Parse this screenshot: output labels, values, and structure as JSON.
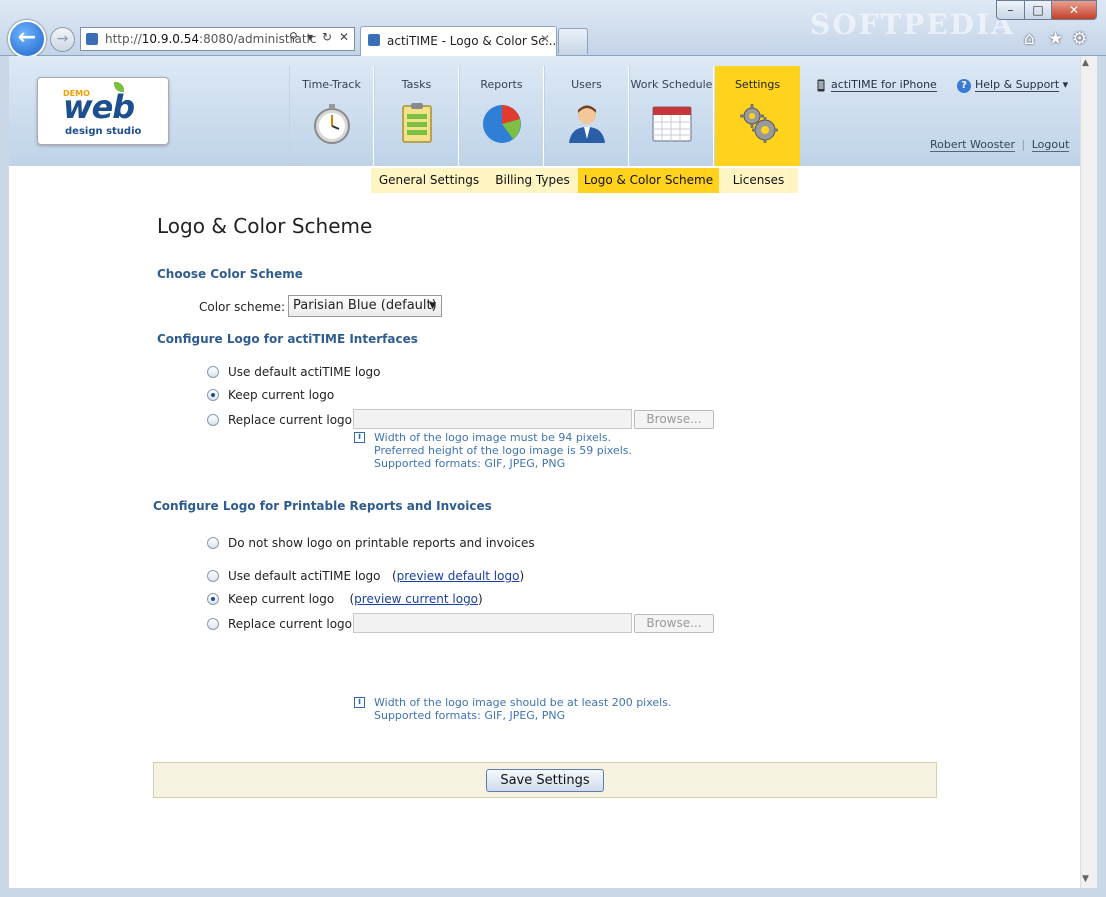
{
  "browser": {
    "url_prefix": "http://",
    "url_host": "10.9.0.54",
    "url_rest": ":8080/administratic",
    "tab_title": "actiTIME - Logo & Color Sc...",
    "watermark": "SOFTPEDIA",
    "min_label": "–",
    "max_label": "□",
    "close_label": "✕",
    "back_glyph": "←",
    "forward_glyph": "→",
    "search_glyph": "⚲",
    "dropdown_glyph": "▾",
    "refresh_glyph": "↻",
    "stop_glyph": "✕",
    "home_glyph": "⌂",
    "star_glyph": "★",
    "gear_glyph": "⚙"
  },
  "logo": {
    "demo": "DEMO",
    "word": "web",
    "sub": "design studio"
  },
  "nav": {
    "tabs": [
      {
        "label": "Time-Track",
        "icon": "stopwatch-icon"
      },
      {
        "label": "Tasks",
        "icon": "clipboard-icon"
      },
      {
        "label": "Reports",
        "icon": "pie-chart-icon"
      },
      {
        "label": "Users",
        "icon": "user-icon"
      },
      {
        "label": "Work Schedule",
        "icon": "calendar-icon"
      },
      {
        "label": "Settings",
        "icon": "gears-icon"
      }
    ],
    "active_tab": "Settings",
    "sub_tabs": [
      "General Settings",
      "Billing Types",
      "Logo & Color Scheme",
      "Licenses"
    ],
    "active_sub_tab": "Logo & Color Scheme",
    "iphone_link": "actiTIME for iPhone",
    "help_link": "Help & Support",
    "help_glyph": "?",
    "help_arrow": "▾",
    "user_name": "Robert Wooster",
    "separator": "|",
    "logout": "Logout"
  },
  "main": {
    "title": "Logo & Color Scheme",
    "color_section": {
      "heading": "Choose Color Scheme",
      "label": "Color scheme:",
      "selected": "Parisian Blue (default)",
      "arrow": "▼"
    },
    "interface_logo": {
      "heading": "Configure Logo for actiTIME Interfaces",
      "options": [
        {
          "label": "Use default actiTIME logo",
          "checked": false
        },
        {
          "label": "Keep current logo",
          "checked": true
        },
        {
          "label": "Replace current logo:",
          "checked": false
        }
      ],
      "browse": "Browse...",
      "info": [
        "Width of the logo image must be 94 pixels.",
        "Preferred height of the logo image is 59 pixels.",
        "Supported formats: GIF, JPEG, PNG"
      ]
    },
    "print_logo": {
      "heading": "Configure Logo for Printable Reports and Invoices",
      "options": [
        {
          "label": "Do not show logo on printable reports and invoices",
          "checked": false,
          "link": ""
        },
        {
          "label": "Use default actiTIME logo",
          "checked": false,
          "link": "preview default logo"
        },
        {
          "label": "Keep current logo",
          "checked": true,
          "link": "preview current logo"
        },
        {
          "label": "Replace current logo:",
          "checked": false,
          "link": ""
        }
      ],
      "browse": "Browse...",
      "info": [
        "Width of the logo image should be at least 200 pixels.",
        "Supported formats: GIF, JPEG, PNG"
      ]
    },
    "info_glyph": "i",
    "paren_open": "(",
    "paren_close": ")",
    "save_label": "Save Settings"
  },
  "colors": {
    "accent_yellow": "#ffd21e",
    "heading_blue": "#2f5c8f",
    "info_blue": "#3f74b0"
  }
}
